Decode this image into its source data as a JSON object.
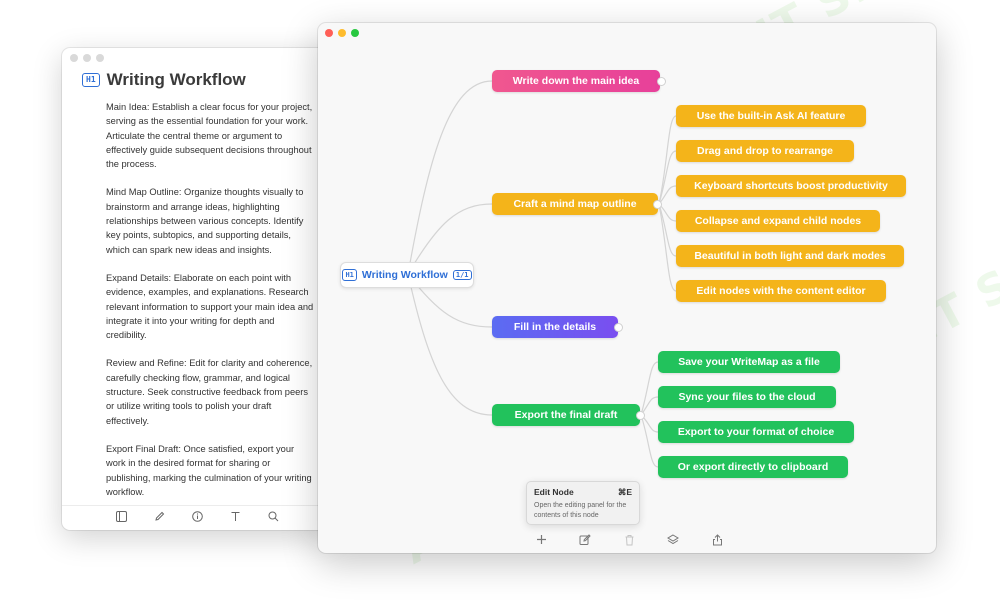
{
  "watermark": {
    "text": "AI TALENT SPACE"
  },
  "document_window": {
    "heading_badge": "H1",
    "title": "Writing Workflow",
    "paragraphs": [
      "Main Idea: Establish a clear focus for your project, serving as the essential foundation for your work. Articulate the central theme or argument to effectively guide subsequent decisions throughout the process.",
      "Mind Map Outline: Organize thoughts visually to brainstorm and arrange ideas, highlighting relationships between various concepts. Identify key points, subtopics, and supporting details, which can spark new ideas and insights.",
      "Expand Details: Elaborate on each point with evidence, examples, and explanations. Research relevant information to support your main idea and integrate it into your writing for depth and credibility.",
      "Review and Refine: Edit for clarity and coherence, carefully checking flow, grammar, and logical structure. Seek constructive feedback from peers or utilize writing tools to polish your draft effectively.",
      "Export Final Draft: Once satisfied, export your work in the desired format for sharing or publishing, marking the culmination of your writing workflow."
    ],
    "toolbar_icons": [
      "sidebar-icon",
      "pencil-icon",
      "info-icon",
      "text-format-icon",
      "search-icon"
    ]
  },
  "mindmap_window": {
    "root": {
      "badge": "H1",
      "title": "Writing Workflow",
      "page": "1/1"
    },
    "branches": [
      {
        "label": "Write down the main idea",
        "color": "#ea4c93",
        "children": []
      },
      {
        "label": "Craft a mind map outline",
        "color": "#f4b41a",
        "children": [
          "Use the built-in Ask AI feature",
          "Drag and drop to rearrange",
          "Keyboard shortcuts boost productivity",
          "Collapse and expand child nodes",
          "Beautiful in both light and dark modes",
          "Edit nodes with the content editor"
        ]
      },
      {
        "label": "Fill in the details",
        "color": "#6a5cf1",
        "children": []
      },
      {
        "label": "Export the final draft",
        "color": "#22c25c",
        "children": [
          "Save your WriteMap as a file",
          "Sync your files to the cloud",
          "Export to your format of choice",
          "Or export directly to clipboard"
        ]
      }
    ],
    "tooltip": {
      "title": "Edit Node",
      "shortcut": "⌘E",
      "description": "Open the editing panel for the contents of this node"
    },
    "toolbar_icons": [
      "add-node-icon",
      "edit-node-icon",
      "delete-icon",
      "layers-icon",
      "share-icon"
    ]
  }
}
